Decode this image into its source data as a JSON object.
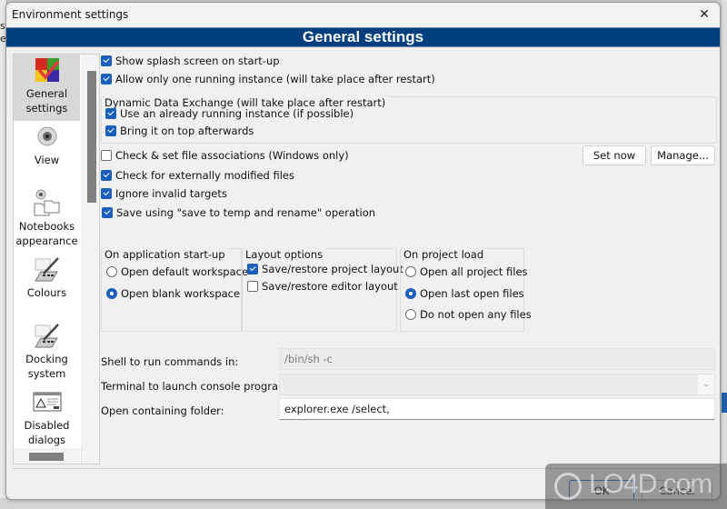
{
  "window": {
    "title": "Environment settings",
    "close_icon": "close-icon"
  },
  "banner": {
    "title": "General settings"
  },
  "sidebar": {
    "items": [
      {
        "label_line1": "General",
        "label_line2": "settings",
        "icon": "general-settings-icon",
        "active": true
      },
      {
        "label_line1": "View",
        "label_line2": "",
        "icon": "view-eye-icon",
        "active": false
      },
      {
        "label_line1": "Notebooks",
        "label_line2": "appearance",
        "icon": "notebooks-icon",
        "active": false
      },
      {
        "label_line1": "Colours",
        "label_line2": "",
        "icon": "colours-icon",
        "active": false
      },
      {
        "label_line1": "Docking",
        "label_line2": "system",
        "icon": "docking-icon",
        "active": false
      },
      {
        "label_line1": "Disabled",
        "label_line2": "dialogs",
        "icon": "warning-dialog-icon",
        "active": false
      }
    ]
  },
  "general": {
    "show_splash": {
      "label": "Show splash screen on start-up",
      "checked": true
    },
    "single_instance": {
      "label": "Allow only one running instance (will take place after restart)",
      "checked": true
    },
    "dde": {
      "legend": "Dynamic Data Exchange (will take place after restart)",
      "use_running": {
        "label": "Use an already running instance (if possible)",
        "checked": true
      },
      "bring_on_top": {
        "label": "Bring it on top afterwards",
        "checked": true
      }
    },
    "file_assoc": {
      "label": "Check & set file associations (Windows only)",
      "checked": false
    },
    "set_now_label": "Set now",
    "manage_label": "Manage...",
    "check_modified": {
      "label": "Check for externally modified files",
      "checked": true
    },
    "ignore_invalid": {
      "label": "Ignore invalid targets",
      "checked": true
    },
    "save_temp": {
      "label": "Save using \"save to temp and rename\" operation",
      "checked": true
    }
  },
  "startup": {
    "legend": "On application start-up",
    "options": [
      {
        "label": "Open default workspace",
        "selected": false
      },
      {
        "label": "Open blank workspace",
        "selected": true
      }
    ]
  },
  "layout": {
    "legend": "Layout options",
    "options": [
      {
        "label": "Save/restore project layout",
        "checked": true
      },
      {
        "label": "Save/restore editor layout",
        "checked": false
      }
    ]
  },
  "project_load": {
    "legend": "On project load",
    "options": [
      {
        "label": "Open all project files",
        "selected": false
      },
      {
        "label": "Open last open files",
        "selected": true
      },
      {
        "label": "Do not open any files",
        "selected": false
      }
    ]
  },
  "commands": {
    "shell_label": "Shell to run commands in:",
    "shell_value": "/bin/sh -c",
    "terminal_label": "Terminal to launch console programs:",
    "terminal_value": "",
    "folder_label": "Open containing folder:",
    "folder_value": "explorer.exe /select,"
  },
  "footer": {
    "ok_label": "OK",
    "cancel_label": "Cancel"
  },
  "watermark": {
    "text": "LO4D.com"
  },
  "colors": {
    "banner": "#003f7f",
    "accent": "#1b5fbd"
  }
}
